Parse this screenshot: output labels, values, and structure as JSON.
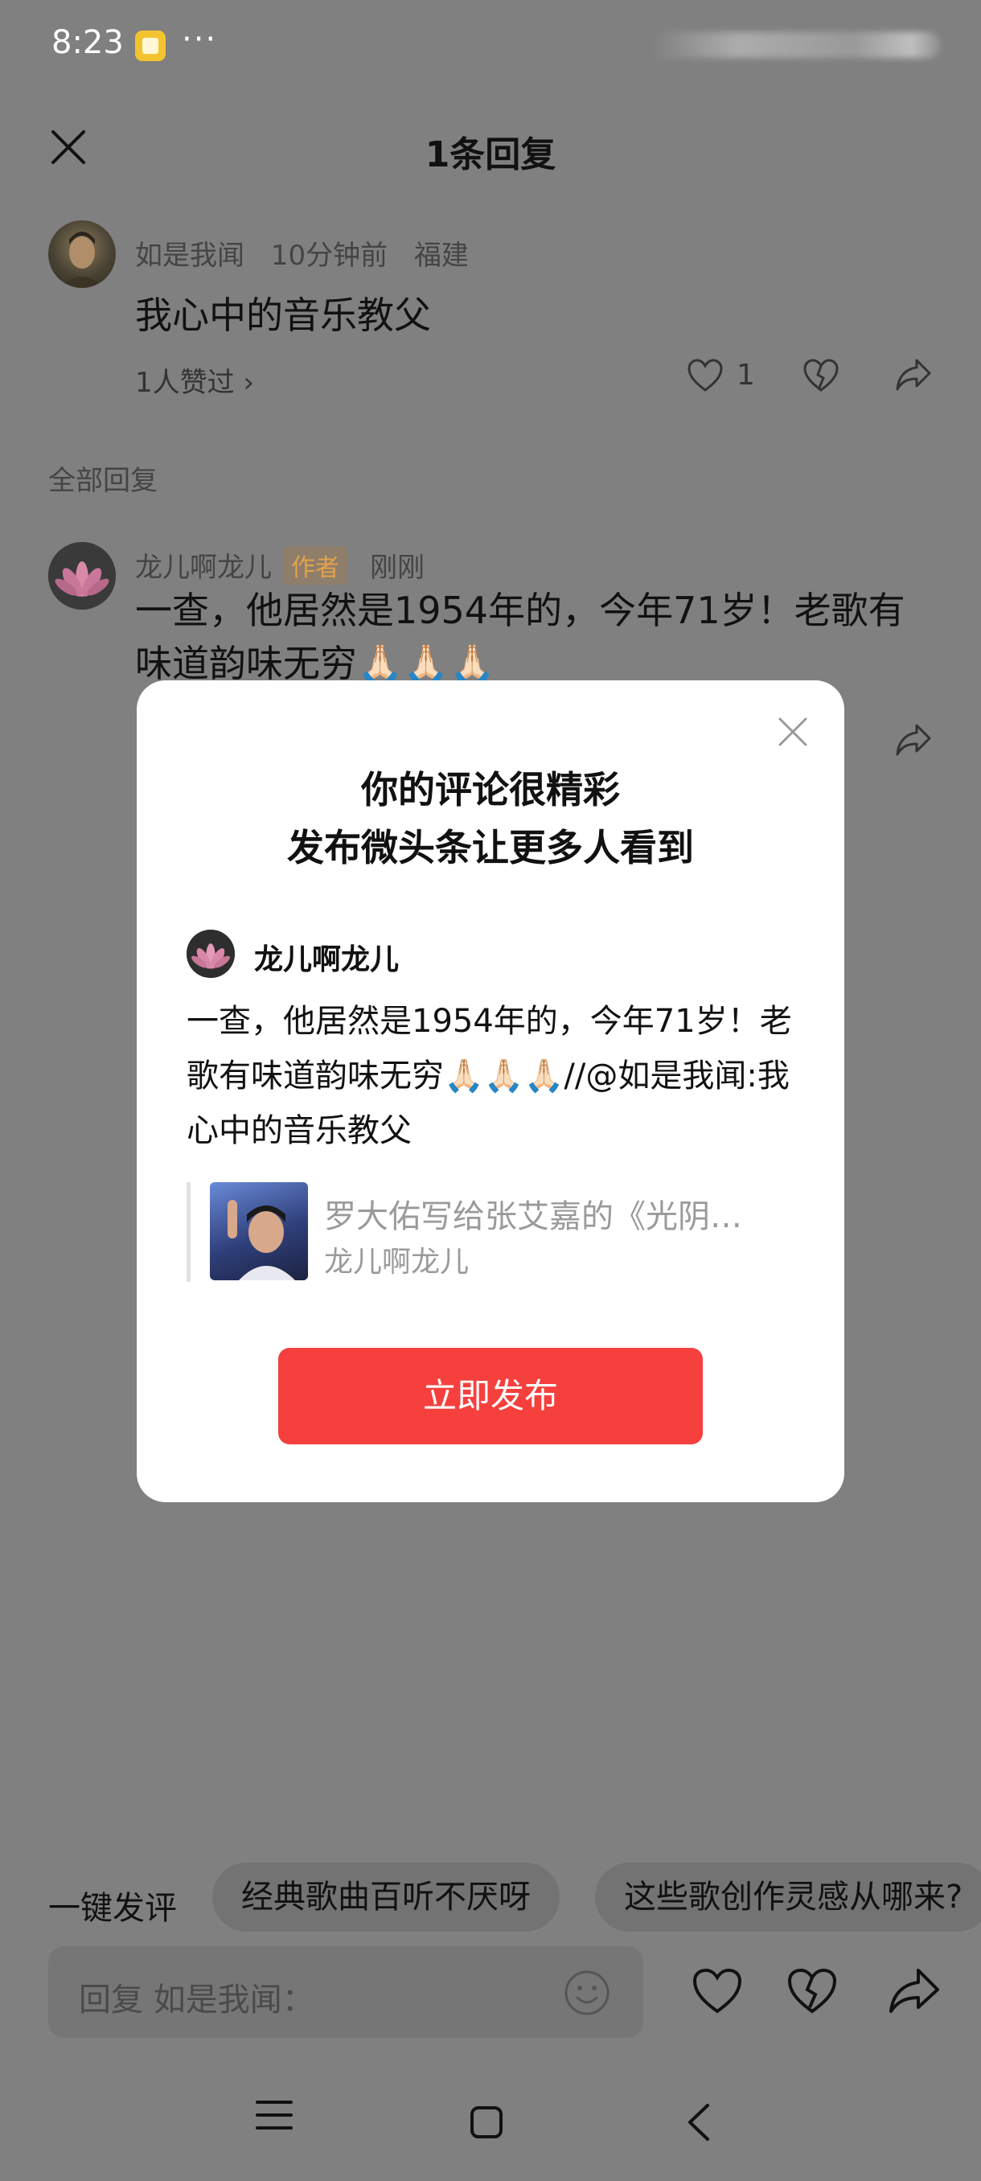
{
  "status_bar": {
    "time": "8:23",
    "more": "···"
  },
  "header": {
    "title": "1条回复"
  },
  "comment": {
    "author": "如是我闻",
    "time_ago": "10分钟前",
    "location": "福建",
    "text": "我心中的音乐教父",
    "liked_by": "1人赞过 ›",
    "like_count": "1"
  },
  "section": {
    "all_replies": "全部回复"
  },
  "reply": {
    "author": "龙儿啊龙儿",
    "badge": "作者",
    "time_ago": "刚刚",
    "text": "一查，他居然是1954年的，今年71岁！老歌有味道韵味无穷🙏🏻🙏🏻🙏🏻"
  },
  "modal": {
    "title_line1": "你的评论很精彩",
    "title_line2": "发布微头条让更多人看到",
    "username": "龙儿啊龙儿",
    "text": "一查，他居然是1954年的，今年71岁！老歌有味道韵味无穷🙏🏻🙏🏻🙏🏻//@如是我闻:我心中的音乐教父",
    "quote_title": "罗大佑写给张艾嘉的《光阴…",
    "quote_author": "龙儿啊龙儿",
    "publish_button": "立即发布"
  },
  "bottom": {
    "quick_label": "一键发评",
    "chips": [
      "经典歌曲百听不厌呀",
      "这些歌创作灵感从哪来?"
    ],
    "reply_placeholder": "回复 如是我闻："
  },
  "colors": {
    "overlay": "#808080",
    "publish": "#f5403d",
    "badge_text": "#e3a24a"
  }
}
